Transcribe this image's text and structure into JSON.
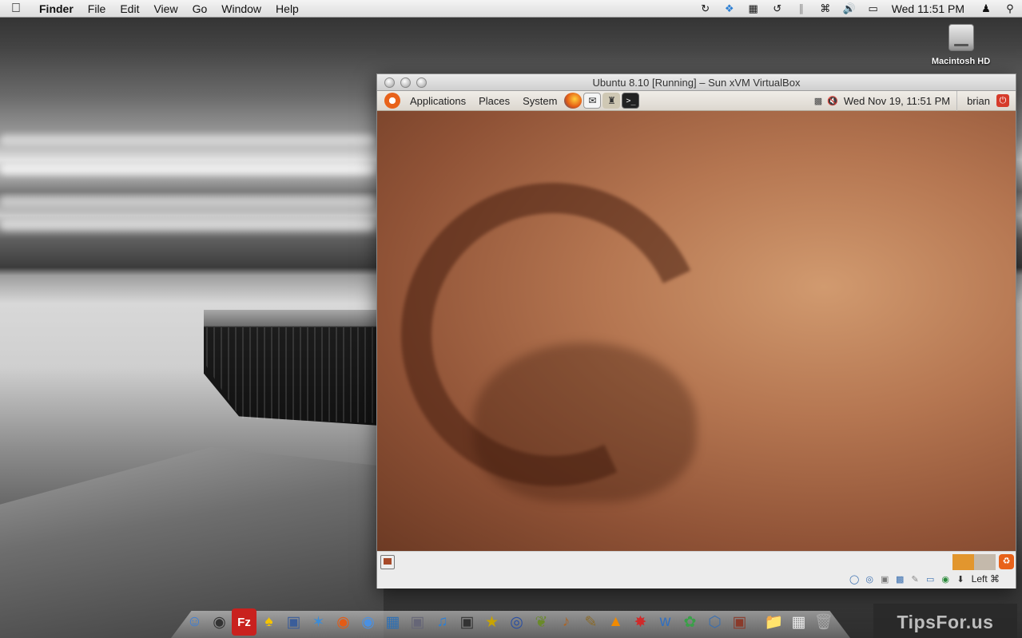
{
  "menubar": {
    "apple_icon": "apple-icon",
    "app_name": "Finder",
    "menus": [
      "File",
      "Edit",
      "View",
      "Go",
      "Window",
      "Help"
    ],
    "clock": "Wed 11:51 PM"
  },
  "desktop": {
    "hd_label": "Macintosh HD"
  },
  "vbox": {
    "title": "Ubuntu 8.10 [Running] – Sun xVM VirtualBox",
    "ubuntu_panel": {
      "menus": [
        "Applications",
        "Places",
        "System"
      ],
      "clock": "Wed Nov 19, 11:51 PM",
      "user": "brian"
    },
    "host_key": "Left ⌘"
  },
  "watermark": "TipsFor.us",
  "colors": {
    "ubuntu_orange": "#e8621a",
    "menubar": "#dcdcdc",
    "ubuntu_panel": "#dcd7cf"
  }
}
